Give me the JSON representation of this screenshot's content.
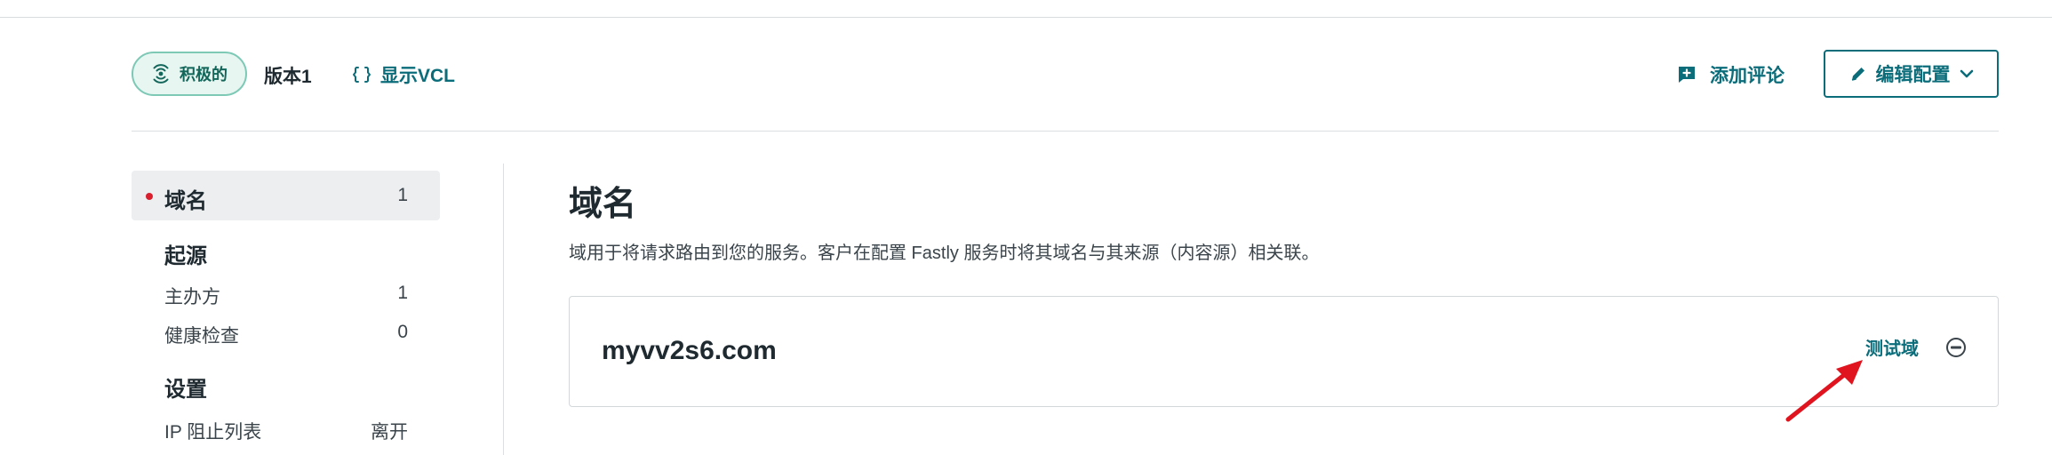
{
  "header": {
    "status_label": "积极的",
    "version_label": "版本1",
    "show_vcl_label": "显示VCL",
    "add_comment_label": "添加评论",
    "edit_config_label": "编辑配置"
  },
  "sidebar": {
    "active_item": {
      "label": "域名",
      "count": "1"
    },
    "sections": [
      {
        "heading": "起源",
        "items": [
          {
            "label": "主办方",
            "value": "1"
          },
          {
            "label": "健康检查",
            "value": "0"
          }
        ]
      },
      {
        "heading": "设置",
        "items": [
          {
            "label": "IP 阻止列表",
            "value": "离开"
          }
        ]
      }
    ]
  },
  "main": {
    "title": "域名",
    "description": "域用于将请求路由到您的服务。客户在配置 Fastly 服务时将其域名与其来源（内容源）相关联。",
    "domains": [
      {
        "name": "myvv2s6.com",
        "test_label": "测试域"
      }
    ]
  },
  "colors": {
    "accent": "#0b6c7a",
    "status_green": "#12665a",
    "status_bg": "#e7f6f1",
    "annotation_red": "#e0141e"
  },
  "icons": [
    "signal-icon",
    "braces-icon",
    "comment-plus-icon",
    "pencil-icon",
    "chevron-down-icon",
    "minus-circle-icon",
    "annotation-arrow"
  ]
}
